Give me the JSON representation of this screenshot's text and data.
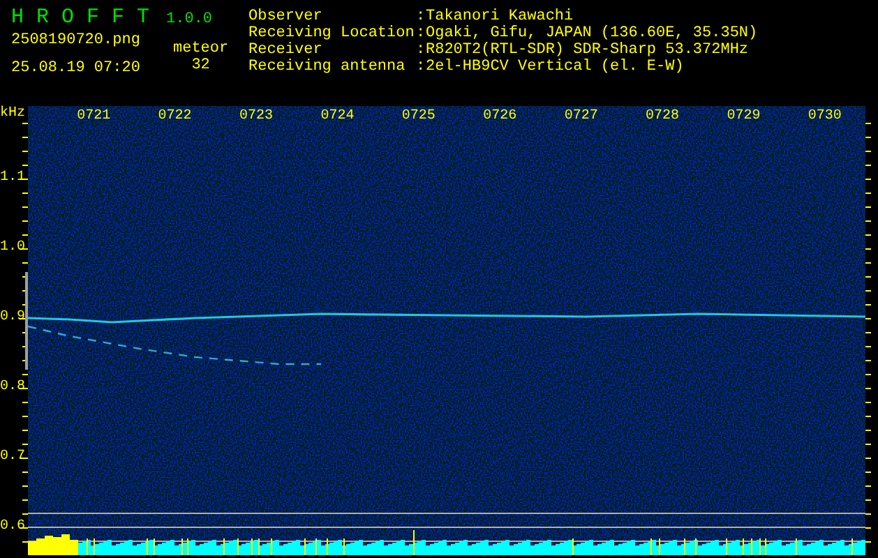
{
  "app": {
    "name": "H R O F F T",
    "version": "1.0.0"
  },
  "file": {
    "filename": "2508190720.png",
    "datetime": "25.08.19 07:20"
  },
  "meteor": {
    "label": "meteor",
    "count": "32"
  },
  "station": [
    {
      "label": "Observer",
      "separator": ":",
      "value": "Takanori Kawachi"
    },
    {
      "label": "Receiving Location",
      "separator": ":",
      "value": "Ogaki, Gifu, JAPAN (136.60E, 35.35N)"
    },
    {
      "label": "Receiver",
      "separator": ":",
      "value": "R820T2(RTL-SDR) SDR-Sharp 53.372MHz"
    },
    {
      "label": "Receiving antenna",
      "separator": ":",
      "value": "2el-HB9CV Vertical (el. E-W)"
    }
  ],
  "spectrogram": {
    "y_unit": "kHz",
    "y_labels": [
      "1.1",
      "1.0",
      "0.9",
      "0.8",
      "0.7",
      "0.6"
    ],
    "time_labels": [
      "0721",
      "0722",
      "0723",
      "0724",
      "0725",
      "0726",
      "0727",
      "0728",
      "0729",
      "0730"
    ]
  }
}
